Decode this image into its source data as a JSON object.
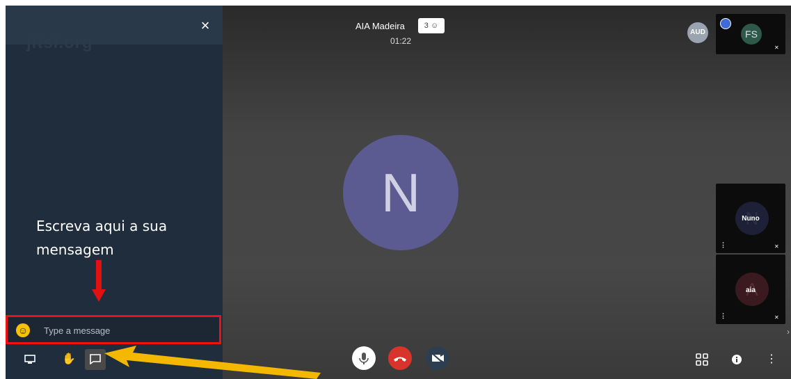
{
  "conference": {
    "title": "AIA Madeira",
    "participant_count": "3",
    "timer": "01:22"
  },
  "chat": {
    "watermark": "jitsi.org",
    "close_glyph": "×",
    "placeholder": "Type a message",
    "annotation": "Escreva aqui a sua mensagem"
  },
  "main_participant": {
    "initial": "N"
  },
  "header_avatar": {
    "label": "AUD"
  },
  "thumbnails": [
    {
      "initials": "FS",
      "name": ""
    },
    {
      "initials": "N",
      "name": "Nuno"
    },
    {
      "initials": "A",
      "name": "aia"
    }
  ],
  "colors": {
    "accent_red": "#e11111",
    "annotation_yellow": "#f5b800",
    "hangup": "#d9342b"
  },
  "icons": {
    "toolbar_left": [
      "screen-share-icon",
      "raise-hand-icon",
      "chat-icon"
    ],
    "toolbar_center": [
      "microphone-icon",
      "hangup-icon",
      "camera-off-icon"
    ],
    "toolbar_right": [
      "tile-view-icon",
      "info-icon",
      "more-options-icon"
    ]
  }
}
